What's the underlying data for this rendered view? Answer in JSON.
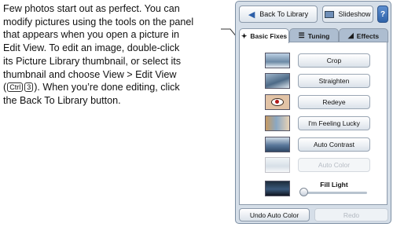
{
  "description": {
    "line1": "Few photos start out as perfect. You can",
    "line2": "modify pictures using the tools on the panel",
    "line3": "that appears when you open a picture in",
    "line4": "Edit View. To edit an image, double-click",
    "line5": "its Picture Library thumbnail, or select its",
    "line6": "thumbnail and choose View > Edit View",
    "line7_before": "(",
    "key_ctrl": "Ctrl",
    "key_3": "3",
    "line7_after": "). When you’re done editing, click",
    "line8": "the Back To Library button."
  },
  "toolbar": {
    "back_label": "Back To Library",
    "slideshow_label": "Slideshow",
    "help_label": "?"
  },
  "tabs": [
    {
      "label": "Basic Fixes",
      "icon": "wand-icon"
    },
    {
      "label": "Tuning",
      "icon": "sliders-icon"
    },
    {
      "label": "Effects",
      "icon": "effects-icon"
    }
  ],
  "actions": [
    {
      "label": "Crop",
      "enabled": true,
      "thumb": "crop-thumbnail"
    },
    {
      "label": "Straighten",
      "enabled": true,
      "thumb": "straighten-thumbnail"
    },
    {
      "label": "Redeye",
      "enabled": true,
      "thumb": "redeye-thumbnail"
    },
    {
      "label": "I'm Feeling Lucky",
      "enabled": true,
      "thumb": "lucky-thumbnail"
    },
    {
      "label": "Auto Contrast",
      "enabled": true,
      "thumb": "contrast-thumbnail"
    },
    {
      "label": "Auto Color",
      "enabled": false,
      "thumb": "color-thumbnail"
    }
  ],
  "fill_light": {
    "label": "Fill Light",
    "value": 0
  },
  "bottom": {
    "undo_label": "Undo Auto Color",
    "redo_label": "Redo"
  },
  "colors": {
    "panel_bg": "#d5dee8",
    "accent": "#2d5fa8",
    "disabled_text": "#b6bcc4"
  }
}
